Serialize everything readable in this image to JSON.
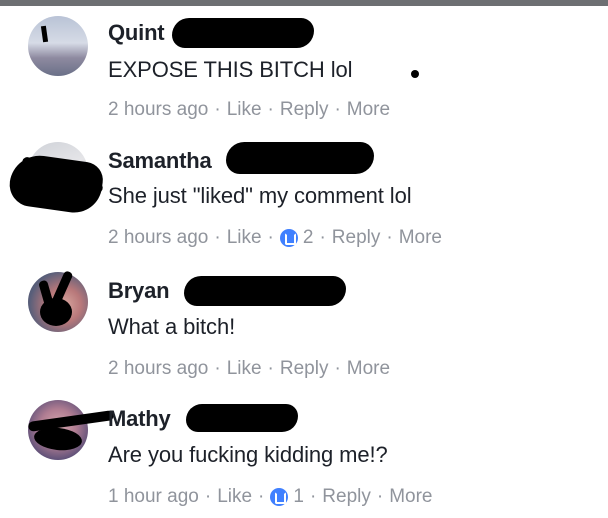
{
  "comments": [
    {
      "author": "Quint",
      "text": "EXPOSE THIS BITCH lol",
      "time": "2 hours ago",
      "like_label": "Like",
      "reply_label": "Reply",
      "more_label": "More",
      "likes": ""
    },
    {
      "author": "Samantha",
      "text": "She just \"liked\" my comment lol",
      "time": "2 hours ago",
      "like_label": "Like",
      "reply_label": "Reply",
      "more_label": "More",
      "likes": "2"
    },
    {
      "author": "Bryan",
      "text": "What a bitch!",
      "time": "2 hours ago",
      "like_label": "Like",
      "reply_label": "Reply",
      "more_label": "More",
      "likes": ""
    },
    {
      "author": "Mathy",
      "text": "Are you fucking kidding me!?",
      "time": "1 hour ago",
      "like_label": "Like",
      "reply_label": "Reply",
      "more_label": "More",
      "likes": "1"
    }
  ],
  "colors": {
    "author": "#1d2129",
    "meta": "#90949c",
    "like_badge": "#4080ff",
    "redaction": "#000000"
  }
}
